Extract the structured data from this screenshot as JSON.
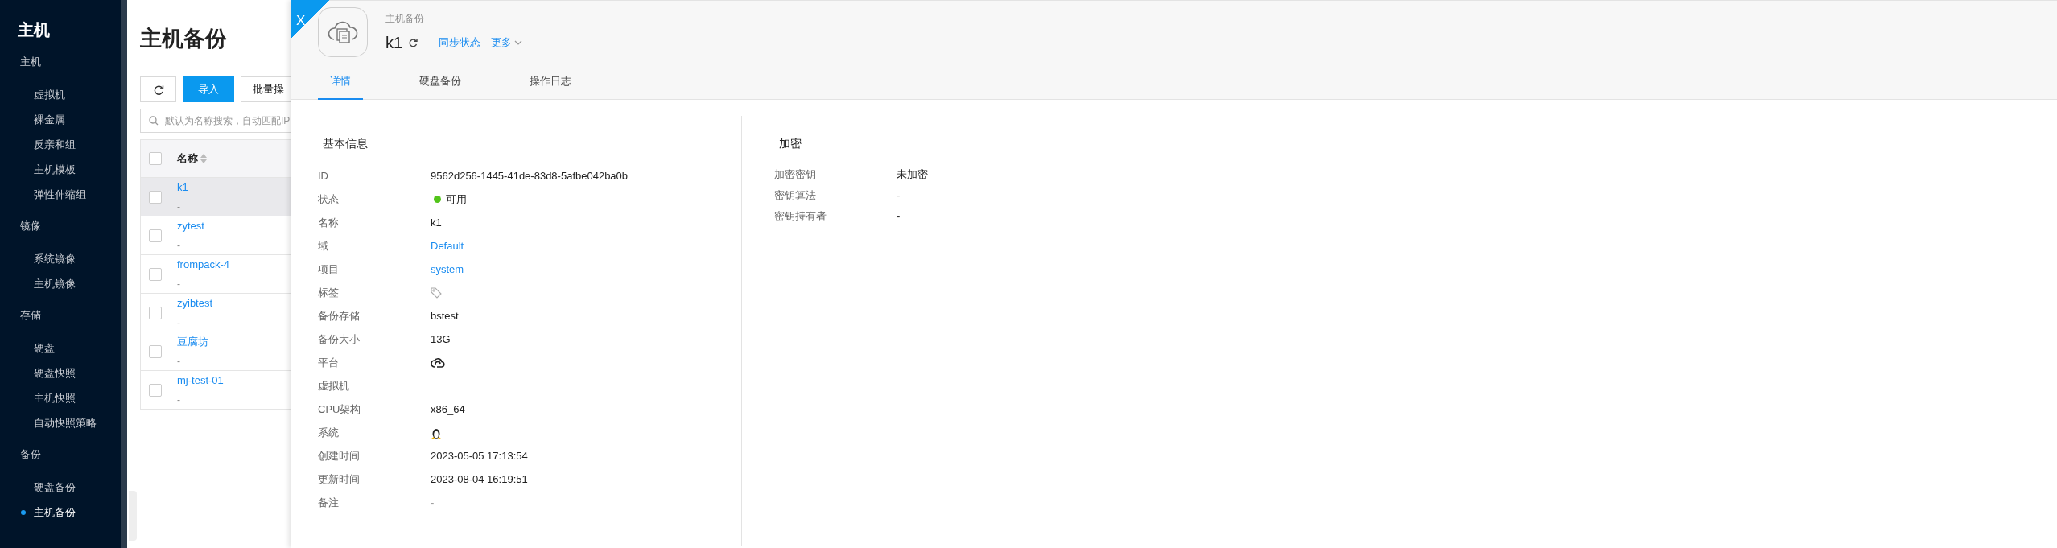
{
  "sidebar": {
    "title": "主机",
    "groups": [
      {
        "label": "主机",
        "items": [
          {
            "label": "虚拟机",
            "selected": false
          },
          {
            "label": "裸金属",
            "selected": false
          },
          {
            "label": "反亲和组",
            "selected": false
          },
          {
            "label": "主机模板",
            "selected": false
          },
          {
            "label": "弹性伸缩组",
            "selected": false
          }
        ]
      },
      {
        "label": "镜像",
        "items": [
          {
            "label": "系统镜像",
            "selected": false
          },
          {
            "label": "主机镜像",
            "selected": false
          }
        ]
      },
      {
        "label": "存储",
        "items": [
          {
            "label": "硬盘",
            "selected": false
          },
          {
            "label": "硬盘快照",
            "selected": false
          },
          {
            "label": "主机快照",
            "selected": false
          },
          {
            "label": "自动快照策略",
            "selected": false
          }
        ]
      },
      {
        "label": "备份",
        "items": [
          {
            "label": "硬盘备份",
            "selected": false
          },
          {
            "label": "主机备份",
            "selected": true
          }
        ]
      }
    ]
  },
  "list_panel": {
    "title": "主机备份",
    "buttons": [
      {
        "kind": "refresh"
      },
      {
        "kind": "primary",
        "label": "导入"
      },
      {
        "kind": "default",
        "label": "批量操"
      }
    ],
    "search": {
      "placeholder": "默认为名称搜索，自动匹配IP"
    },
    "table": {
      "header_checked": false,
      "columns": [
        "名称"
      ],
      "rows": [
        {
          "name": "k1",
          "subtitle": "-",
          "selected": true,
          "checked": false
        },
        {
          "name": "zytest",
          "subtitle": "-",
          "selected": false,
          "checked": false
        },
        {
          "name": "frompack-4",
          "subtitle": "-",
          "selected": false,
          "checked": false
        },
        {
          "name": "zyibtest",
          "subtitle": "-",
          "selected": false,
          "checked": false
        },
        {
          "name": "豆腐坊",
          "subtitle": "-",
          "selected": false,
          "checked": false
        },
        {
          "name": "mj-test-01",
          "subtitle": "-",
          "selected": false,
          "checked": false
        }
      ]
    }
  },
  "drawer": {
    "close": "X",
    "breadcrumb": "主机备份",
    "title": "k1",
    "actions": [
      {
        "label": "同步状态",
        "dropdown": false
      },
      {
        "label": "更多",
        "dropdown": true
      }
    ],
    "tabs": [
      {
        "label": "详情",
        "selected": true
      },
      {
        "label": "硬盘备份",
        "selected": false
      },
      {
        "label": "操作日志",
        "selected": false
      }
    ],
    "sections": [
      {
        "title": "基本信息",
        "fields": [
          {
            "label": "ID",
            "kind": "text",
            "value": "9562d256-1445-41de-83d8-5afbe042ba0b"
          },
          {
            "label": "状态",
            "kind": "status",
            "value": "可用",
            "color": "#52c41a"
          },
          {
            "label": "名称",
            "kind": "text",
            "value": "k1"
          },
          {
            "label": "域",
            "kind": "link",
            "value": "Default"
          },
          {
            "label": "项目",
            "kind": "link",
            "value": "system"
          },
          {
            "label": "标签",
            "kind": "tag"
          },
          {
            "label": "备份存储",
            "kind": "text",
            "value": "bstest"
          },
          {
            "label": "备份大小",
            "kind": "text",
            "value": "13G"
          },
          {
            "label": "平台",
            "kind": "platform"
          },
          {
            "label": "虚拟机",
            "kind": "empty"
          },
          {
            "label": "CPU架构",
            "kind": "text",
            "value": "x86_64"
          },
          {
            "label": "系统",
            "kind": "os"
          },
          {
            "label": "创建时间",
            "kind": "text",
            "value": "2023-05-05 17:13:54"
          },
          {
            "label": "更新时间",
            "kind": "text",
            "value": "2023-08-04 16:19:51"
          },
          {
            "label": "备注",
            "kind": "muted",
            "value": "-"
          }
        ]
      },
      {
        "title": "加密",
        "fields": [
          {
            "label": "加密密钥",
            "kind": "text",
            "value": "未加密"
          },
          {
            "label": "密钥算法",
            "kind": "text",
            "value": "-"
          },
          {
            "label": "密钥持有者",
            "kind": "text",
            "value": "-"
          }
        ]
      }
    ]
  }
}
